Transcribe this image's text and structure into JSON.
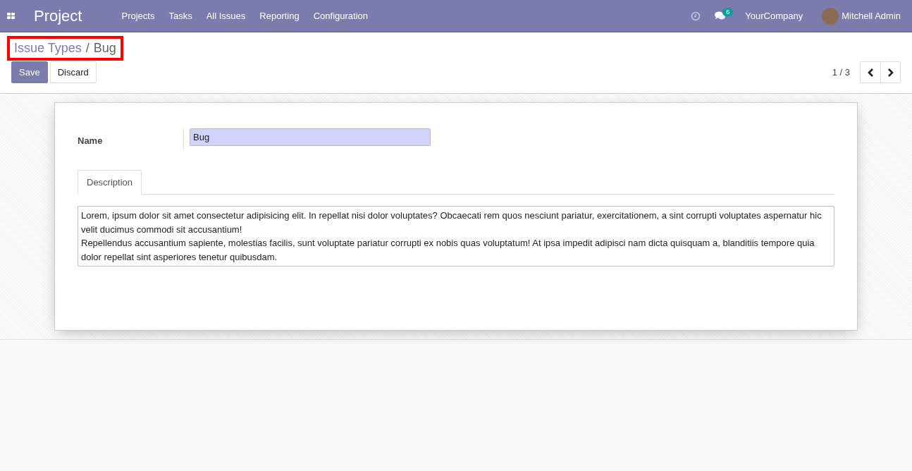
{
  "navbar": {
    "app_title": "Project",
    "menu": [
      "Projects",
      "Tasks",
      "All Issues",
      "Reporting",
      "Configuration"
    ],
    "messages_badge": "6",
    "company": "YourCompany",
    "user": "Mitchell Admin"
  },
  "breadcrumb": {
    "parent": "Issue Types",
    "separator": "/",
    "current": "Bug",
    "highlighted": true
  },
  "buttons": [
    "Save",
    "Discard"
  ],
  "pager": {
    "value": "1 / 3"
  },
  "form": {
    "name_label": "Name",
    "name_value": "Bug",
    "tabs": [
      {
        "label": "Description",
        "selected": true
      }
    ],
    "description": [
      "Lorem, ipsum dolor sit amet consectetur adipisicing elit. In repellat nisi dolor voluptates? Obcaecati rem quos nesciunt pariatur, exercitationem, a sint corrupti voluptates aspernatur hic velit ducimus commodi sit accusantium!",
      "Repellendus accusantium sapiente, molestias facilis, sunt voluptate pariatur corrupti ex nobis quas voluptatum! At ipsa impedit adipisci nam dicta quisquam a, blanditiis tempore quia dolor repellat sint asperiores tenetur quibusdam."
    ]
  }
}
